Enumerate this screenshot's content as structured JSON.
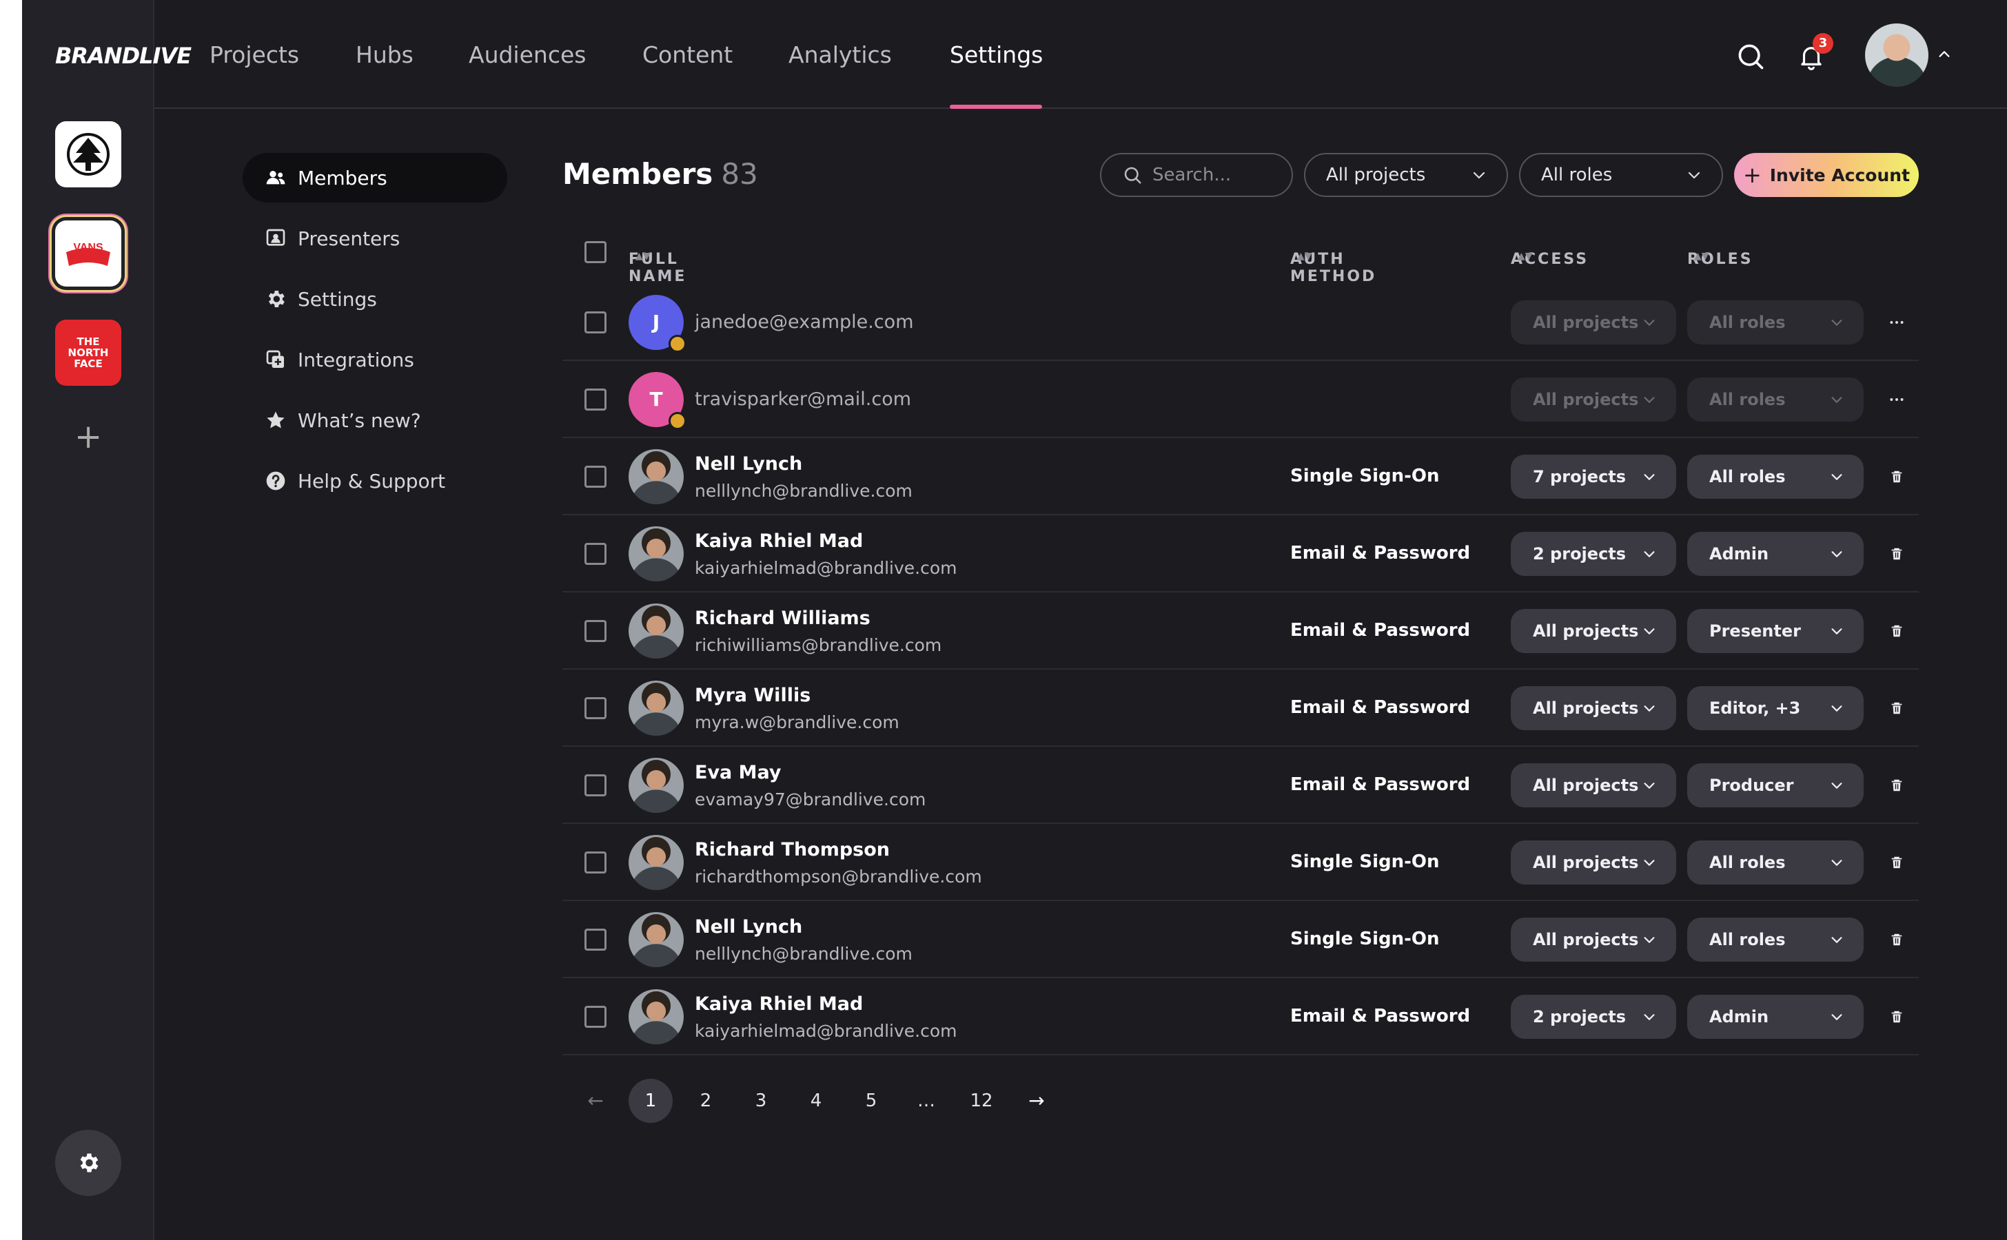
{
  "app": {
    "logo": "BRANDLIVE"
  },
  "brands": [
    {
      "name": "Timberland"
    },
    {
      "name": "VANS OFF THE WALL",
      "label": "VANS"
    },
    {
      "name": "THE NORTH FACE",
      "label": "THE NORTH FACE"
    }
  ],
  "nav": {
    "items": [
      {
        "label": "Projects"
      },
      {
        "label": "Hubs"
      },
      {
        "label": "Audiences"
      },
      {
        "label": "Content"
      },
      {
        "label": "Analytics"
      },
      {
        "label": "Settings"
      }
    ],
    "active": "Settings",
    "notifications": "3"
  },
  "subnav": {
    "items": [
      {
        "label": "Members",
        "icon": "users-icon"
      },
      {
        "label": "Presenters",
        "icon": "presenter-icon"
      },
      {
        "label": "Settings",
        "icon": "gear-icon"
      },
      {
        "label": "Integrations",
        "icon": "integrations-icon"
      },
      {
        "label": "What’s new?",
        "icon": "star-icon"
      },
      {
        "label": "Help & Support",
        "icon": "help-icon"
      }
    ]
  },
  "page": {
    "title": "Members",
    "count": "83"
  },
  "filters": {
    "search_placeholder": "Search...",
    "projects": "All projects",
    "roles": "All roles",
    "invite": "Invite Account"
  },
  "table": {
    "headers": {
      "name": "FULL NAME",
      "auth": "AUTH METHOD",
      "access": "ACCESS",
      "roles": "ROLES"
    },
    "rows": [
      {
        "initial": "J",
        "color": "#5b5ee6",
        "name": "",
        "email": "janedoe@example.com",
        "auth": "",
        "access": "All projects",
        "role": "All roles",
        "pending": true
      },
      {
        "initial": "T",
        "color": "#e2549f",
        "name": "",
        "email": "travisparker@mail.com",
        "auth": "",
        "access": "All projects",
        "role": "All roles",
        "pending": true
      },
      {
        "initial": "",
        "name": "Nell Lynch",
        "email": "nelllynch@brandlive.com",
        "auth": "Single Sign-On",
        "access": "7 projects",
        "role": "All roles"
      },
      {
        "initial": "",
        "name": "Kaiya Rhiel Mad",
        "email": "kaiyarhielmad@brandlive.com",
        "auth": "Email & Password",
        "access": "2 projects",
        "role": "Admin"
      },
      {
        "initial": "",
        "name": "Richard Williams",
        "email": "richiwilliams@brandlive.com",
        "auth": "Email & Password",
        "access": "All projects",
        "role": "Presenter"
      },
      {
        "initial": "",
        "name": "Myra Willis",
        "email": "myra.w@brandlive.com",
        "auth": "Email & Password",
        "access": "All projects",
        "role": "Editor, +3"
      },
      {
        "initial": "",
        "name": "Eva May",
        "email": "evamay97@brandlive.com",
        "auth": "Email & Password",
        "access": "All projects",
        "role": "Producer"
      },
      {
        "initial": "",
        "name": "Richard Thompson",
        "email": "richardthompson@brandlive.com",
        "auth": "Single Sign-On",
        "access": "All projects",
        "role": "All roles"
      },
      {
        "initial": "",
        "name": "Nell Lynch",
        "email": "nelllynch@brandlive.com",
        "auth": "Single Sign-On",
        "access": "All projects",
        "role": "All roles"
      },
      {
        "initial": "",
        "name": "Kaiya Rhiel Mad",
        "email": "kaiyarhielmad@brandlive.com",
        "auth": "Email & Password",
        "access": "2 projects",
        "role": "Admin"
      }
    ]
  },
  "pagination": {
    "pages": [
      "1",
      "2",
      "3",
      "4",
      "5",
      "…",
      "12"
    ],
    "current": "1"
  }
}
